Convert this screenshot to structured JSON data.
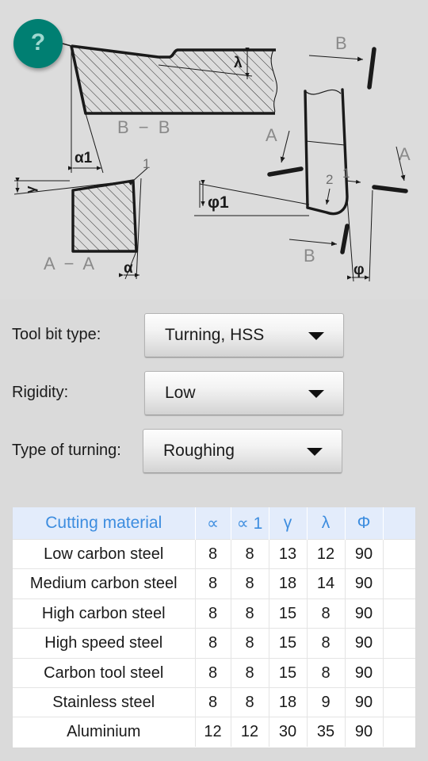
{
  "app": {
    "background_color": "#dadada",
    "accent_color": "#007f72",
    "table_header_color": "#3d8ddf",
    "table_header_bg": "#e3ecfb"
  },
  "help": {
    "icon": "question-mark-icon",
    "label": "?"
  },
  "diagram": {
    "name": "tool-bit-angles-technical-drawing",
    "labels": {
      "section_bb": "B − B",
      "section_aa": "A − A",
      "lambda": "λ",
      "alpha1": "α1",
      "alpha": "α",
      "gamma": "γ",
      "phi1": "φ1",
      "phi": "φ",
      "arrow_b_top": "B",
      "arrow_b_bottom": "B",
      "arrow_a_left": "A",
      "arrow_a_right": "A",
      "callout_1_left": "1",
      "callout_1_right": "1",
      "callout_2": "2"
    }
  },
  "form": {
    "rows": [
      {
        "label": "Tool bit type:",
        "value": "Turning, HSS",
        "name": "tool-bit-type"
      },
      {
        "label": "Rigidity:",
        "value": "Low",
        "name": "rigidity"
      },
      {
        "label": "Type of turning:",
        "value": "Roughing",
        "name": "type-of-turning"
      }
    ]
  },
  "table": {
    "headers": [
      "Cutting material",
      "∝",
      "∝ 1",
      "γ",
      "λ",
      "Φ",
      ""
    ],
    "rows": [
      {
        "material": "Low carbon steel",
        "a": "8",
        "a1": "8",
        "g": "13",
        "l": "12",
        "p": "90"
      },
      {
        "material": "Medium carbon steel",
        "a": "8",
        "a1": "8",
        "g": "18",
        "l": "14",
        "p": "90"
      },
      {
        "material": "High carbon steel",
        "a": "8",
        "a1": "8",
        "g": "15",
        "l": "8",
        "p": "90"
      },
      {
        "material": "High speed steel",
        "a": "8",
        "a1": "8",
        "g": "15",
        "l": "8",
        "p": "90"
      },
      {
        "material": "Carbon tool steel",
        "a": "8",
        "a1": "8",
        "g": "15",
        "l": "8",
        "p": "90"
      },
      {
        "material": "Stainless steel",
        "a": "8",
        "a1": "8",
        "g": "18",
        "l": "9",
        "p": "90"
      },
      {
        "material": "Aluminium",
        "a": "12",
        "a1": "12",
        "g": "30",
        "l": "35",
        "p": "90"
      }
    ]
  }
}
